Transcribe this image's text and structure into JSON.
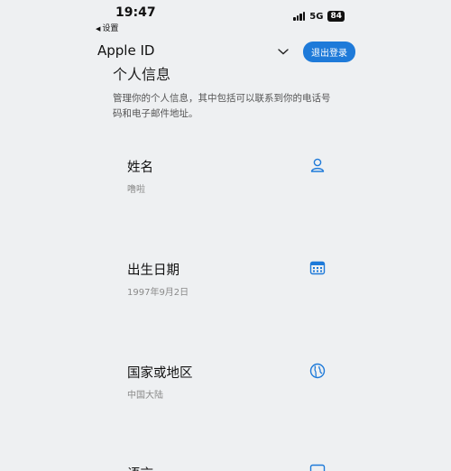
{
  "status_bar": {
    "time": "19:47",
    "back_label": "设置",
    "network": "5G",
    "battery": "84"
  },
  "header": {
    "title": "Apple ID",
    "logout_label": "退出登录"
  },
  "section": {
    "title": "个人信息",
    "description": "管理你的个人信息，其中包括可以联系到你的电话号码和电子邮件地址。"
  },
  "fields": [
    {
      "label": "姓名",
      "value": "噜啦",
      "icon": "person-icon"
    },
    {
      "label": "出生日期",
      "value": "1997年9月2日",
      "icon": "calendar-icon"
    },
    {
      "label": "国家或地区",
      "value": "中国大陆",
      "icon": "globe-icon"
    },
    {
      "label": "语言",
      "value": "",
      "icon": "language-icon"
    }
  ],
  "colors": {
    "accent": "#1e7ad9",
    "background": "#eef0f2"
  }
}
